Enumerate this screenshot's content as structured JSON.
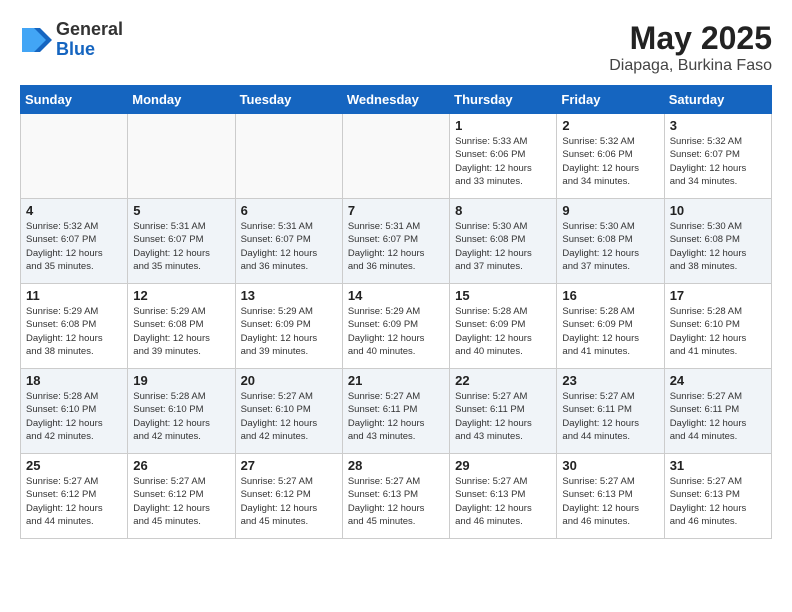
{
  "header": {
    "logo_general": "General",
    "logo_blue": "Blue",
    "month_year": "May 2025",
    "location": "Diapaga, Burkina Faso"
  },
  "days_of_week": [
    "Sunday",
    "Monday",
    "Tuesday",
    "Wednesday",
    "Thursday",
    "Friday",
    "Saturday"
  ],
  "weeks": [
    [
      {
        "day": "",
        "info": ""
      },
      {
        "day": "",
        "info": ""
      },
      {
        "day": "",
        "info": ""
      },
      {
        "day": "",
        "info": ""
      },
      {
        "day": "1",
        "info": "Sunrise: 5:33 AM\nSunset: 6:06 PM\nDaylight: 12 hours\nand 33 minutes."
      },
      {
        "day": "2",
        "info": "Sunrise: 5:32 AM\nSunset: 6:06 PM\nDaylight: 12 hours\nand 34 minutes."
      },
      {
        "day": "3",
        "info": "Sunrise: 5:32 AM\nSunset: 6:07 PM\nDaylight: 12 hours\nand 34 minutes."
      }
    ],
    [
      {
        "day": "4",
        "info": "Sunrise: 5:32 AM\nSunset: 6:07 PM\nDaylight: 12 hours\nand 35 minutes."
      },
      {
        "day": "5",
        "info": "Sunrise: 5:31 AM\nSunset: 6:07 PM\nDaylight: 12 hours\nand 35 minutes."
      },
      {
        "day": "6",
        "info": "Sunrise: 5:31 AM\nSunset: 6:07 PM\nDaylight: 12 hours\nand 36 minutes."
      },
      {
        "day": "7",
        "info": "Sunrise: 5:31 AM\nSunset: 6:07 PM\nDaylight: 12 hours\nand 36 minutes."
      },
      {
        "day": "8",
        "info": "Sunrise: 5:30 AM\nSunset: 6:08 PM\nDaylight: 12 hours\nand 37 minutes."
      },
      {
        "day": "9",
        "info": "Sunrise: 5:30 AM\nSunset: 6:08 PM\nDaylight: 12 hours\nand 37 minutes."
      },
      {
        "day": "10",
        "info": "Sunrise: 5:30 AM\nSunset: 6:08 PM\nDaylight: 12 hours\nand 38 minutes."
      }
    ],
    [
      {
        "day": "11",
        "info": "Sunrise: 5:29 AM\nSunset: 6:08 PM\nDaylight: 12 hours\nand 38 minutes."
      },
      {
        "day": "12",
        "info": "Sunrise: 5:29 AM\nSunset: 6:08 PM\nDaylight: 12 hours\nand 39 minutes."
      },
      {
        "day": "13",
        "info": "Sunrise: 5:29 AM\nSunset: 6:09 PM\nDaylight: 12 hours\nand 39 minutes."
      },
      {
        "day": "14",
        "info": "Sunrise: 5:29 AM\nSunset: 6:09 PM\nDaylight: 12 hours\nand 40 minutes."
      },
      {
        "day": "15",
        "info": "Sunrise: 5:28 AM\nSunset: 6:09 PM\nDaylight: 12 hours\nand 40 minutes."
      },
      {
        "day": "16",
        "info": "Sunrise: 5:28 AM\nSunset: 6:09 PM\nDaylight: 12 hours\nand 41 minutes."
      },
      {
        "day": "17",
        "info": "Sunrise: 5:28 AM\nSunset: 6:10 PM\nDaylight: 12 hours\nand 41 minutes."
      }
    ],
    [
      {
        "day": "18",
        "info": "Sunrise: 5:28 AM\nSunset: 6:10 PM\nDaylight: 12 hours\nand 42 minutes."
      },
      {
        "day": "19",
        "info": "Sunrise: 5:28 AM\nSunset: 6:10 PM\nDaylight: 12 hours\nand 42 minutes."
      },
      {
        "day": "20",
        "info": "Sunrise: 5:27 AM\nSunset: 6:10 PM\nDaylight: 12 hours\nand 42 minutes."
      },
      {
        "day": "21",
        "info": "Sunrise: 5:27 AM\nSunset: 6:11 PM\nDaylight: 12 hours\nand 43 minutes."
      },
      {
        "day": "22",
        "info": "Sunrise: 5:27 AM\nSunset: 6:11 PM\nDaylight: 12 hours\nand 43 minutes."
      },
      {
        "day": "23",
        "info": "Sunrise: 5:27 AM\nSunset: 6:11 PM\nDaylight: 12 hours\nand 44 minutes."
      },
      {
        "day": "24",
        "info": "Sunrise: 5:27 AM\nSunset: 6:11 PM\nDaylight: 12 hours\nand 44 minutes."
      }
    ],
    [
      {
        "day": "25",
        "info": "Sunrise: 5:27 AM\nSunset: 6:12 PM\nDaylight: 12 hours\nand 44 minutes."
      },
      {
        "day": "26",
        "info": "Sunrise: 5:27 AM\nSunset: 6:12 PM\nDaylight: 12 hours\nand 45 minutes."
      },
      {
        "day": "27",
        "info": "Sunrise: 5:27 AM\nSunset: 6:12 PM\nDaylight: 12 hours\nand 45 minutes."
      },
      {
        "day": "28",
        "info": "Sunrise: 5:27 AM\nSunset: 6:13 PM\nDaylight: 12 hours\nand 45 minutes."
      },
      {
        "day": "29",
        "info": "Sunrise: 5:27 AM\nSunset: 6:13 PM\nDaylight: 12 hours\nand 46 minutes."
      },
      {
        "day": "30",
        "info": "Sunrise: 5:27 AM\nSunset: 6:13 PM\nDaylight: 12 hours\nand 46 minutes."
      },
      {
        "day": "31",
        "info": "Sunrise: 5:27 AM\nSunset: 6:13 PM\nDaylight: 12 hours\nand 46 minutes."
      }
    ]
  ]
}
